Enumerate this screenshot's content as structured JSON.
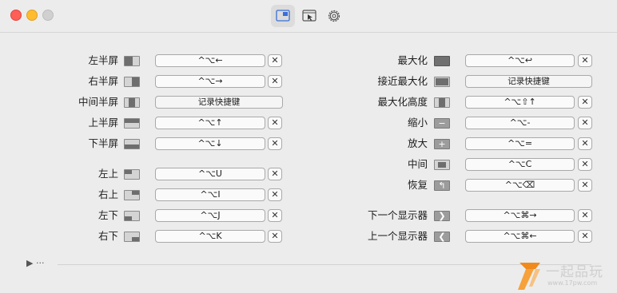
{
  "toolbar": {
    "tabs": [
      {
        "icon": "window-snap-icon",
        "active": true
      },
      {
        "icon": "cursor-window-icon",
        "active": false
      },
      {
        "icon": "gear-icon",
        "active": false
      }
    ]
  },
  "left_column": [
    {
      "label": "左半屏",
      "shortcut": "^⌥←",
      "clearable": true
    },
    {
      "label": "右半屏",
      "shortcut": "^⌥→",
      "clearable": true
    },
    {
      "label": "中间半屏",
      "shortcut": "记录快捷键",
      "clearable": false
    },
    {
      "label": "上半屏",
      "shortcut": "^⌥↑",
      "clearable": true
    },
    {
      "label": "下半屏",
      "shortcut": "^⌥↓",
      "clearable": true
    },
    {
      "label": "左上",
      "shortcut": "^⌥U",
      "clearable": true
    },
    {
      "label": "右上",
      "shortcut": "^⌥I",
      "clearable": true
    },
    {
      "label": "左下",
      "shortcut": "^⌥J",
      "clearable": true
    },
    {
      "label": "右下",
      "shortcut": "^⌥K",
      "clearable": true
    }
  ],
  "right_column": [
    {
      "label": "最大化",
      "shortcut": "^⌥↩",
      "clearable": true
    },
    {
      "label": "接近最大化",
      "shortcut": "记录快捷键",
      "clearable": false
    },
    {
      "label": "最大化高度",
      "shortcut": "^⌥⇧↑",
      "clearable": true
    },
    {
      "label": "缩小",
      "shortcut": "^⌥-",
      "clearable": true
    },
    {
      "label": "放大",
      "shortcut": "^⌥=",
      "clearable": true
    },
    {
      "label": "中间",
      "shortcut": "^⌥C",
      "clearable": true
    },
    {
      "label": "恢复",
      "shortcut": "^⌥⌫",
      "clearable": true
    },
    {
      "label": "下一个显示器",
      "shortcut": "^⌥⌘→",
      "clearable": true
    },
    {
      "label": "上一个显示器",
      "shortcut": "^⌥⌘←",
      "clearable": true
    }
  ],
  "clear_symbol": "✕",
  "footer": {
    "more_label": "▶ ···"
  },
  "watermark": {
    "text": "一起品玩",
    "url": "www.17pw.com"
  }
}
